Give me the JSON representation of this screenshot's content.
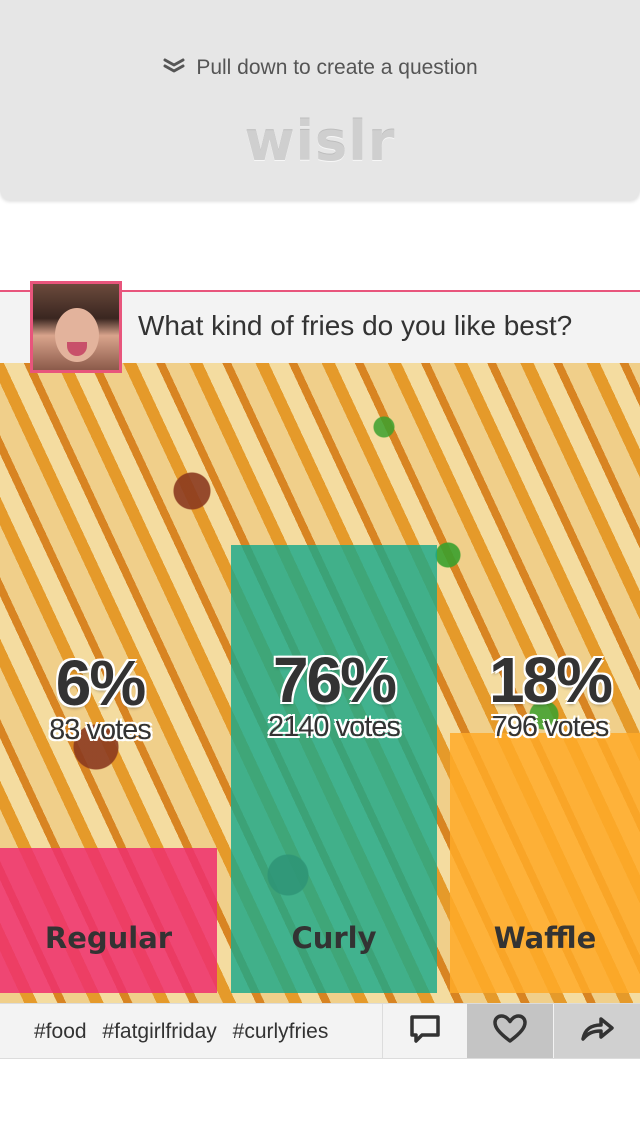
{
  "header": {
    "pull_hint": "Pull down to create a question",
    "logo": "wislr"
  },
  "question": {
    "text": "What kind of fries do you like best?",
    "avatar_icon": "user-avatar"
  },
  "results": [
    {
      "label": "Regular",
      "percent": "6%",
      "votes": "83 votes",
      "fraction": 0.06,
      "color": "#ee2e6e"
    },
    {
      "label": "Curly",
      "percent": "76%",
      "votes": "2140 votes",
      "fraction": 0.76,
      "color": "#1aa88a"
    },
    {
      "label": "Waffle",
      "percent": "18%",
      "votes": "796 votes",
      "fraction": 0.18,
      "color": "#ffaa28"
    }
  ],
  "tags": [
    "#food",
    "#fatgirlfriday",
    "#curlyfries"
  ],
  "actions": {
    "comment_icon": "comment-icon",
    "like_icon": "heart-icon",
    "share_icon": "share-icon"
  },
  "colors": {
    "accent": "#e8557c",
    "header_bg": "#e6e6e6"
  }
}
